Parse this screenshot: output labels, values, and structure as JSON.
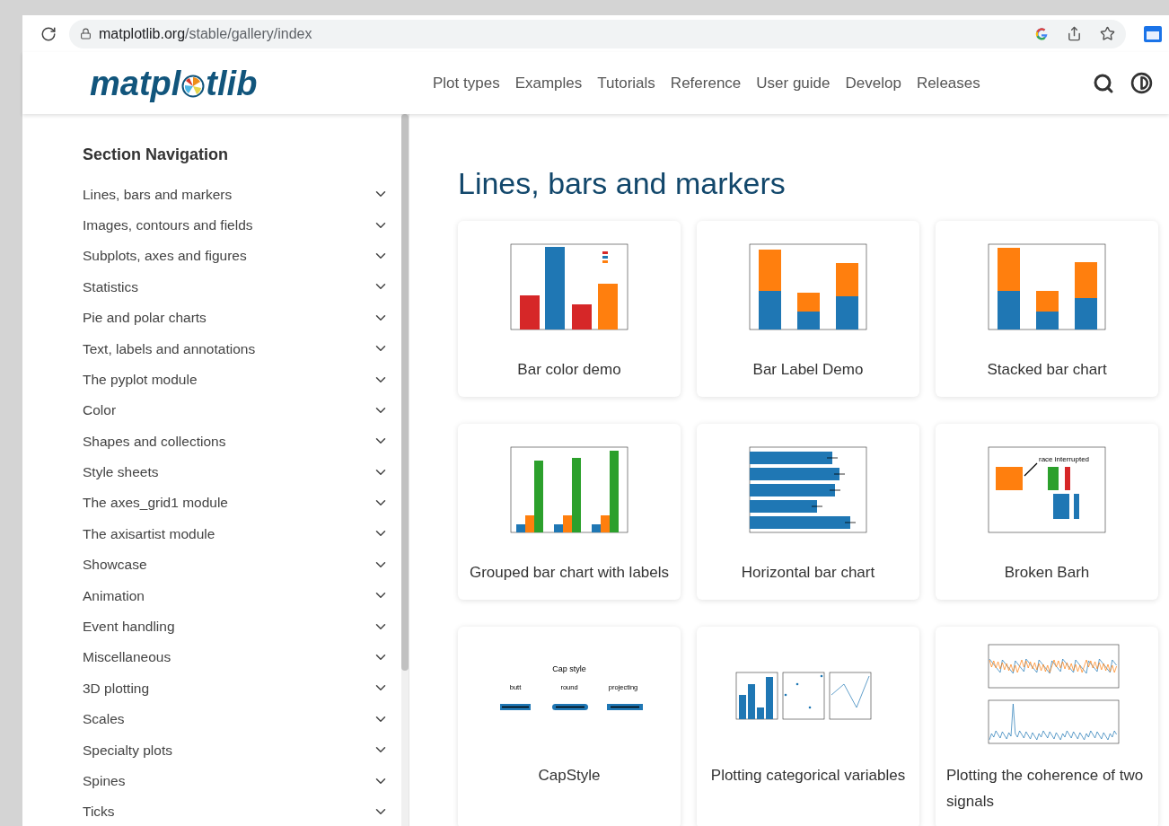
{
  "browser": {
    "url_host": "matplotlib.org",
    "url_path": "/stable/gallery/index"
  },
  "header": {
    "logo": [
      "matpl",
      "tlib"
    ],
    "nav": [
      {
        "label": "Plot types"
      },
      {
        "label": "Examples"
      },
      {
        "label": "Tutorials"
      },
      {
        "label": "Reference"
      },
      {
        "label": "User guide"
      },
      {
        "label": "Develop"
      },
      {
        "label": "Releases"
      }
    ]
  },
  "sidebar": {
    "title": "Section Navigation",
    "items": [
      {
        "label": "Lines, bars and markers",
        "expanded": false
      },
      {
        "label": "Images, contours and fields",
        "expanded": false
      },
      {
        "label": "Subplots, axes and figures",
        "expanded": false
      },
      {
        "label": "Statistics",
        "expanded": false
      },
      {
        "label": "Pie and polar charts",
        "expanded": false
      },
      {
        "label": "Text, labels and annotations",
        "expanded": false
      },
      {
        "label": "The pyplot module",
        "expanded": false
      },
      {
        "label": "Color",
        "expanded": false
      },
      {
        "label": "Shapes and collections",
        "expanded": false
      },
      {
        "label": "Style sheets",
        "expanded": false
      },
      {
        "label": "The axes_grid1 module",
        "expanded": false
      },
      {
        "label": "The axisartist module",
        "expanded": false
      },
      {
        "label": "Showcase",
        "expanded": false
      },
      {
        "label": "Animation",
        "expanded": false
      },
      {
        "label": "Event handling",
        "expanded": false
      },
      {
        "label": "Miscellaneous",
        "expanded": false
      },
      {
        "label": "3D plotting",
        "expanded": false
      },
      {
        "label": "Scales",
        "expanded": false
      },
      {
        "label": "Specialty plots",
        "expanded": false
      },
      {
        "label": "Spines",
        "expanded": false
      },
      {
        "label": "Ticks",
        "expanded": false
      }
    ]
  },
  "content": {
    "heading": "Lines, bars and markers",
    "cards": [
      {
        "title": "Bar color demo",
        "thumbnail": {
          "kind": "bar-color"
        }
      },
      {
        "title": "Bar Label Demo",
        "thumbnail": {
          "kind": "bar-label"
        }
      },
      {
        "title": "Stacked bar chart",
        "thumbnail": {
          "kind": "stacked"
        }
      },
      {
        "title": "Grouped bar chart with labels",
        "thumbnail": {
          "kind": "grouped"
        }
      },
      {
        "title": "Horizontal bar chart",
        "thumbnail": {
          "kind": "hbar"
        }
      },
      {
        "title": "Broken Barh",
        "thumbnail": {
          "kind": "broken-barh",
          "labels": [
            "race interrupted"
          ]
        }
      },
      {
        "title": "CapStyle",
        "thumbnail": {
          "kind": "capstyle",
          "labels": [
            "Cap style",
            "butt",
            "round",
            "projecting"
          ]
        }
      },
      {
        "title": "Plotting categorical variables",
        "thumbnail": {
          "kind": "categorical"
        }
      },
      {
        "title": "Plotting the coherence of two signals",
        "thumbnail": {
          "kind": "coherence"
        }
      }
    ]
  }
}
